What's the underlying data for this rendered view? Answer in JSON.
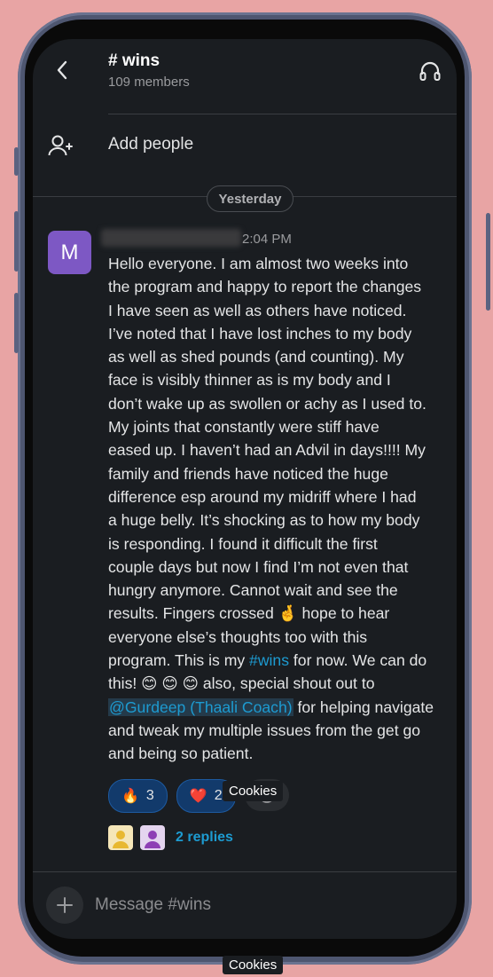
{
  "header": {
    "channel_title": "# wins",
    "member_count": "109 members"
  },
  "add_people": {
    "label": "Add people"
  },
  "date_divider": "Yesterday",
  "message": {
    "avatar_letter": "M",
    "time": "2:04 PM",
    "lines": [
      "Hello everyone. I am almost two weeks into",
      "the program and happy to report the changes",
      "I have seen as well as others have noticed.",
      "I’ve noted that I have lost inches to my body",
      "as well as shed pounds (and counting). My",
      "face is visibly thinner as is my body and I",
      "don’t wake up as swollen or achy as I used to.",
      "My joints that constantly were stiff have",
      "eased up. I haven’t had an Advil in days!!!! My",
      "family and friends have noticed the huge",
      "difference esp around my midriff where I had",
      "a huge belly. It’s shocking as to how my body",
      "is responding. I found it difficult the first",
      "couple days but now I find I’m not even that",
      "hungry anymore. Cannot wait and see the"
    ],
    "line16_before": "results. Fingers crossed ",
    "line16_emoji": "🤞",
    "line16_after": " hope to hear",
    "line17": "everyone else’s thoughts too with this",
    "line18_before": "program. This is my ",
    "line18_link": "#wins",
    "line18_after": " for now. We can do",
    "line19_before": "this! ",
    "line19_emojis": "😊 😊 😊",
    "line19_after": " also, special shout out to",
    "line20_mention": "@Gurdeep (Thaali Coach)",
    "line20_after": " for helping navigate",
    "line21": "and tweak my multiple issues from the get go",
    "line22": "and being so patient."
  },
  "reactions": [
    {
      "emoji": "🔥",
      "count": "3"
    },
    {
      "emoji": "❤️",
      "count": "2"
    }
  ],
  "replies": {
    "label": "2 replies"
  },
  "composer": {
    "placeholder": "Message #wins"
  },
  "overlays": {
    "cookies_mid": "Cookies",
    "cookies_bottom": "Cookies"
  },
  "colors": {
    "background": "#e8a4a4",
    "screen": "#1a1d21",
    "avatar": "#7d58c4",
    "link": "#1d9bd1"
  }
}
